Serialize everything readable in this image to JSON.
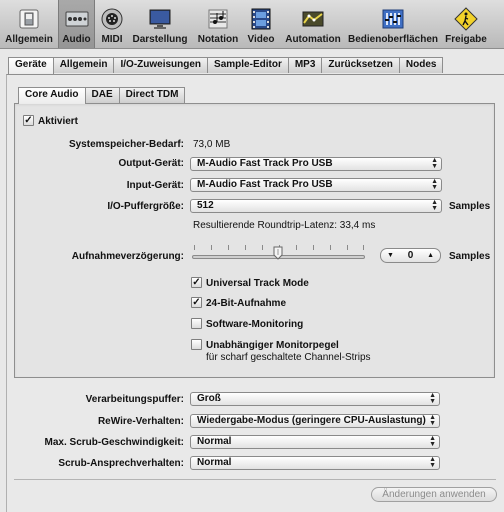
{
  "toolbar": {
    "items": [
      {
        "label": "Allgemein",
        "icon": "switch-icon"
      },
      {
        "label": "Audio",
        "icon": "audio-interface-icon"
      },
      {
        "label": "MIDI",
        "icon": "midi-connector-icon"
      },
      {
        "label": "Darstellung",
        "icon": "monitor-icon"
      },
      {
        "label": "Notation",
        "icon": "notation-icon"
      },
      {
        "label": "Video",
        "icon": "film-icon"
      },
      {
        "label": "Automation",
        "icon": "automation-icon"
      },
      {
        "label": "Bedienoberflächen",
        "icon": "control-surface-icon"
      },
      {
        "label": "Freigabe",
        "icon": "share-sign-icon"
      }
    ],
    "selected": "Audio"
  },
  "main_tabs": [
    "Geräte",
    "Allgemein",
    "I/O-Zuweisungen",
    "Sample-Editor",
    "MP3",
    "Zurücksetzen",
    "Nodes"
  ],
  "device_tabs": [
    "Core Audio",
    "DAE",
    "Direct TDM"
  ],
  "core_audio": {
    "enabled_label": "Aktiviert",
    "enabled": true,
    "system_memory_label": "Systemspeicher-Bedarf:",
    "system_memory_value": "73,0 MB",
    "output_label": "Output-Gerät:",
    "output_value": "M-Audio Fast Track Pro USB",
    "input_label": "Input-Gerät:",
    "input_value": "M-Audio Fast Track Pro USB",
    "buffer_label": "I/O-Puffergröße:",
    "buffer_value": "512",
    "buffer_unit": "Samples",
    "latency_text": "Resultierende Roundtrip-Latenz: 33,4 ms",
    "delay_label": "Aufnahmeverzögerung:",
    "delay_value": "0",
    "delay_unit": "Samples",
    "delay_slider_fraction": 0.5,
    "universal_track_mode_label": "Universal Track Mode",
    "universal_track_mode": true,
    "bit24_label": "24-Bit-Aufnahme",
    "bit24": true,
    "software_monitoring_label": "Software-Monitoring",
    "software_monitoring": false,
    "independent_monitor_label": "Unabhängiger Monitorpegel",
    "independent_monitor_sub": "für scharf geschaltete Channel-Strips",
    "independent_monitor": false
  },
  "processing_buffer_label": "Verarbeitungspuffer:",
  "processing_buffer_value": "Groß",
  "rewire_label": "ReWire-Verhalten:",
  "rewire_value": "Wiedergabe-Modus (geringere CPU-Auslastung)",
  "scrub_speed_label": "Max. Scrub-Geschwindigkeit:",
  "scrub_speed_value": "Normal",
  "scrub_response_label": "Scrub-Ansprechverhalten:",
  "scrub_response_value": "Normal",
  "apply_label": "Änderungen anwenden"
}
